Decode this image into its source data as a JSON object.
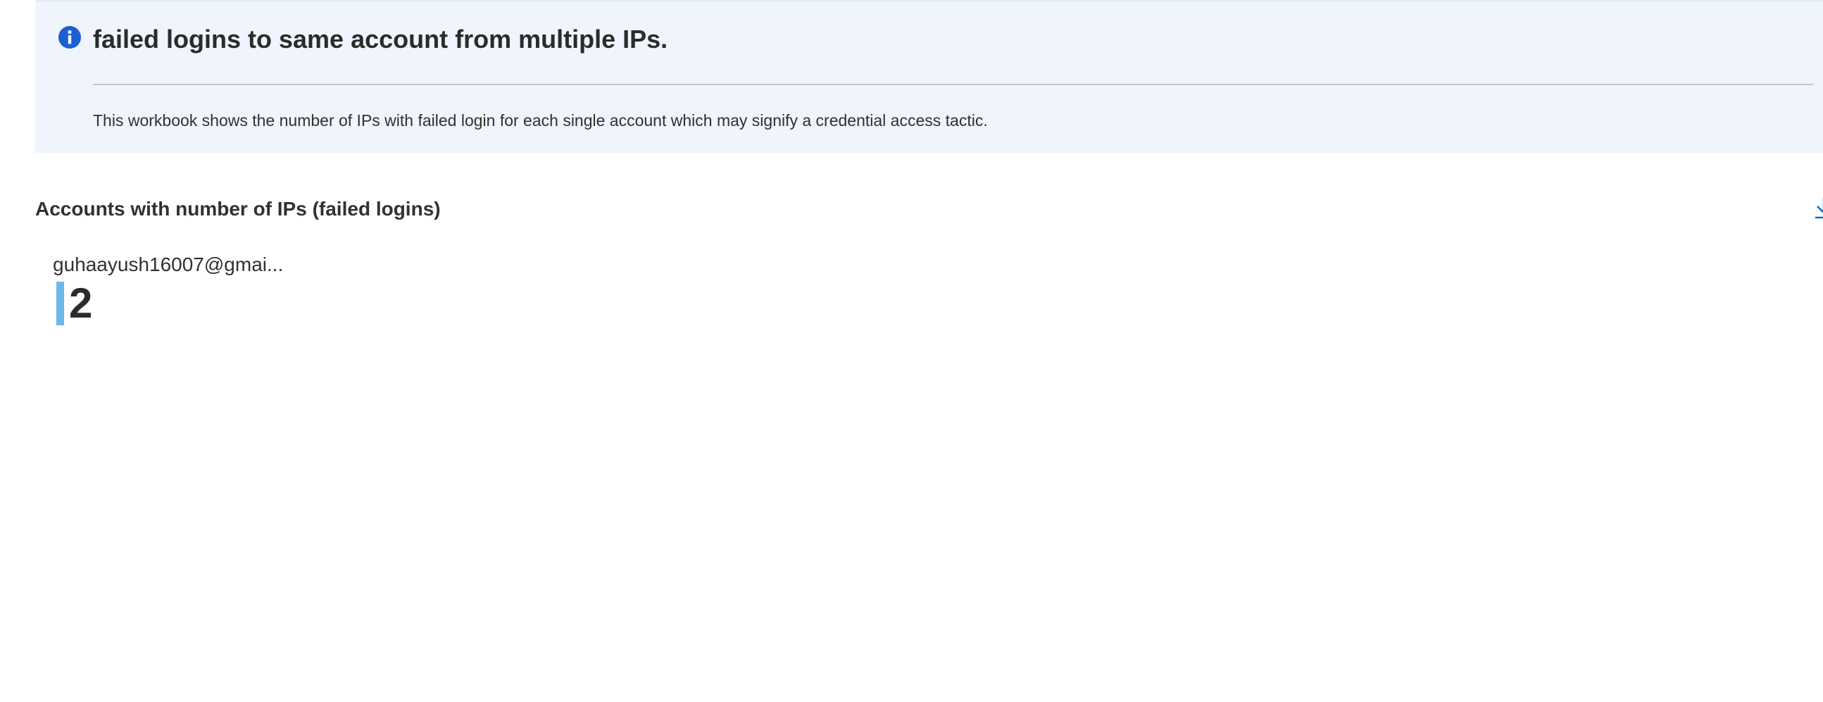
{
  "banner": {
    "icon": "info-icon",
    "title": "failed logins to same account from multiple IPs.",
    "description": "This workbook shows the number of IPs with failed login for each single account which may signify a credential access tactic."
  },
  "section": {
    "title": "Accounts with number of IPs (failed logins)",
    "download_icon": "download-icon"
  },
  "tiles": [
    {
      "label": "guhaayush16007@gmai...",
      "value": "2"
    }
  ],
  "colors": {
    "banner_bg": "#eff4fd",
    "info_icon": "#1a5fd4",
    "bar": "#6cb8e6",
    "link": "#0f6cbd"
  }
}
